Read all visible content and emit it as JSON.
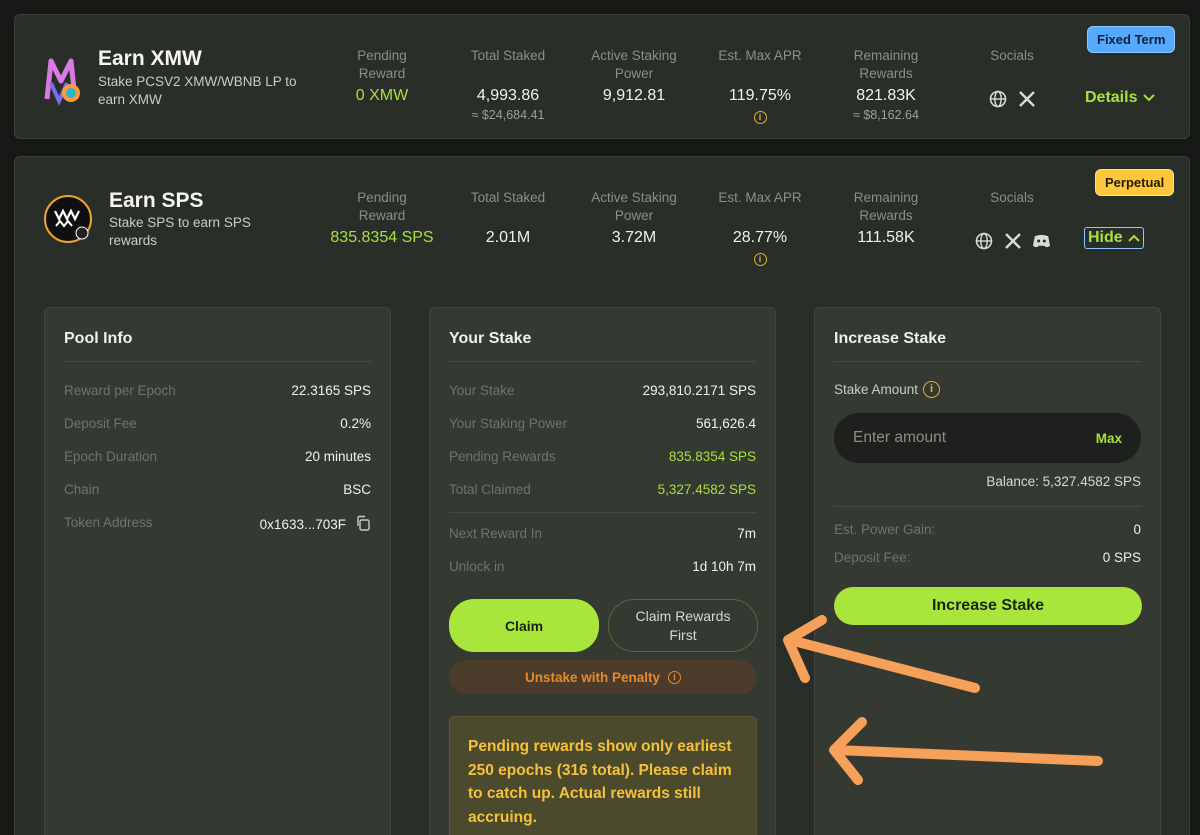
{
  "colors": {
    "accent_green": "#a8e03c",
    "penalty_orange": "#e88a2c",
    "notice_yellow": "#f5c13a",
    "badge_blue": "#55a9ff",
    "badge_yellow": "#ffc83a",
    "annotation_orange": "#f6a05a"
  },
  "stat_labels": {
    "pending_reward": "Pending Reward",
    "total_staked": "Total Staked",
    "active_staking_power": "Active Staking Power",
    "est_max_apr": "Est. Max APR",
    "remaining_rewards": "Remaining Rewards",
    "socials": "Socials"
  },
  "pool_xmw": {
    "title": "Earn XMW",
    "subtitle": "Stake PCSV2 XMW/WBNB LP to earn XMW",
    "badge": "Fixed Term",
    "pending_reward": "0 XMW",
    "total_staked": "4,993.86",
    "total_staked_usd": "≈ $24,684.41",
    "active_staking_power": "9,912.81",
    "est_max_apr": "119.75%",
    "remaining_rewards": "821.83K",
    "remaining_rewards_usd": "≈ $8,162.64",
    "details_label": "Details",
    "social_icons": [
      "globe-icon",
      "x-icon"
    ]
  },
  "pool_sps": {
    "title": "Earn SPS",
    "subtitle": "Stake SPS to earn SPS rewards",
    "badge": "Perpetual",
    "pending_reward": "835.8354 SPS",
    "total_staked": "2.01M",
    "active_staking_power": "3.72M",
    "est_max_apr": "28.77%",
    "remaining_rewards": "111.58K",
    "hide_label": "Hide",
    "social_icons": [
      "globe-icon",
      "x-icon",
      "discord-icon"
    ]
  },
  "pool_info": {
    "title": "Pool Info",
    "rows": [
      {
        "label": "Reward per Epoch",
        "value": "22.3165 SPS"
      },
      {
        "label": "Deposit Fee",
        "value": "0.2%"
      },
      {
        "label": "Epoch Duration",
        "value": "20 minutes"
      },
      {
        "label": "Chain",
        "value": "BSC"
      },
      {
        "label": "Token Address",
        "value": "0x1633...703F"
      }
    ]
  },
  "your_stake": {
    "title": "Your Stake",
    "rows": [
      {
        "label": "Your Stake",
        "value": "293,810.2171 SPS"
      },
      {
        "label": "Your Staking Power",
        "value": "561,626.4"
      },
      {
        "label": "Pending Rewards",
        "value": "835.8354 SPS"
      },
      {
        "label": "Total Claimed",
        "value": "5,327.4582 SPS"
      },
      {
        "label": "Next Reward In",
        "value": "7m"
      },
      {
        "label": "Unlock in",
        "value": "1d 10h 7m"
      }
    ],
    "claim_label": "Claim",
    "claim_rewards_first_label": "Claim Rewards First",
    "unstake_label": "Unstake with Penalty",
    "notice": "Pending rewards show only earliest 250 epochs (316 total). Please claim to catch up. Actual rewards still accruing."
  },
  "increase_stake": {
    "title": "Increase Stake",
    "stake_amount_label": "Stake Amount",
    "input_placeholder": "Enter amount",
    "max_label": "Max",
    "balance_text": "Balance: 5,327.4582 SPS",
    "rows": [
      {
        "label": "Est. Power Gain:",
        "value": "0"
      },
      {
        "label": "Deposit Fee:",
        "value": "0 SPS"
      }
    ],
    "button_label": "Increase Stake"
  }
}
